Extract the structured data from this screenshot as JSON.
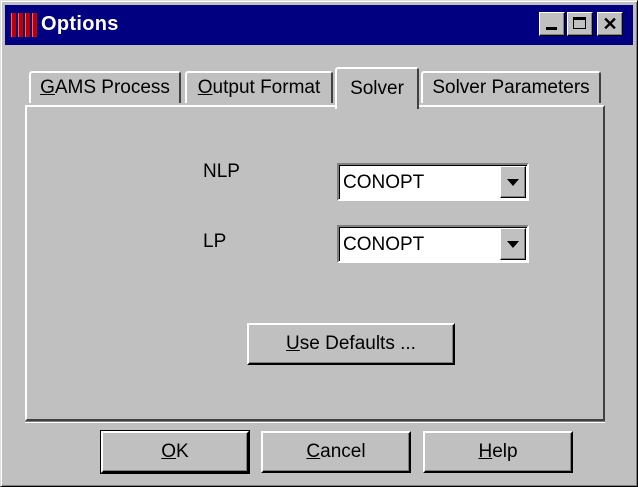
{
  "window": {
    "title": "Options",
    "minimize_icon": "minimize-icon",
    "maximize_icon": "maximize-icon",
    "close_glyph": "✕"
  },
  "tabs": [
    {
      "pre": "",
      "u": "G",
      "post": "AMS Process",
      "active": false
    },
    {
      "pre": "",
      "u": "O",
      "post": "utput Format",
      "active": false
    },
    {
      "pre": "Solver",
      "u": "",
      "post": "",
      "active": true
    },
    {
      "pre": "Solver Parameters",
      "u": "",
      "post": "",
      "active": false
    }
  ],
  "solver": {
    "nlp_label": "NLP",
    "nlp_value": "CONOPT",
    "lp_label": "LP",
    "lp_value": "CONOPT",
    "defaults_pre": "",
    "defaults_u": "U",
    "defaults_post": "se Defaults ..."
  },
  "buttons": {
    "ok_u": "O",
    "ok_post": "K",
    "cancel_u": "C",
    "cancel_post": "ancel",
    "help_u": "H",
    "help_post": "elp"
  }
}
